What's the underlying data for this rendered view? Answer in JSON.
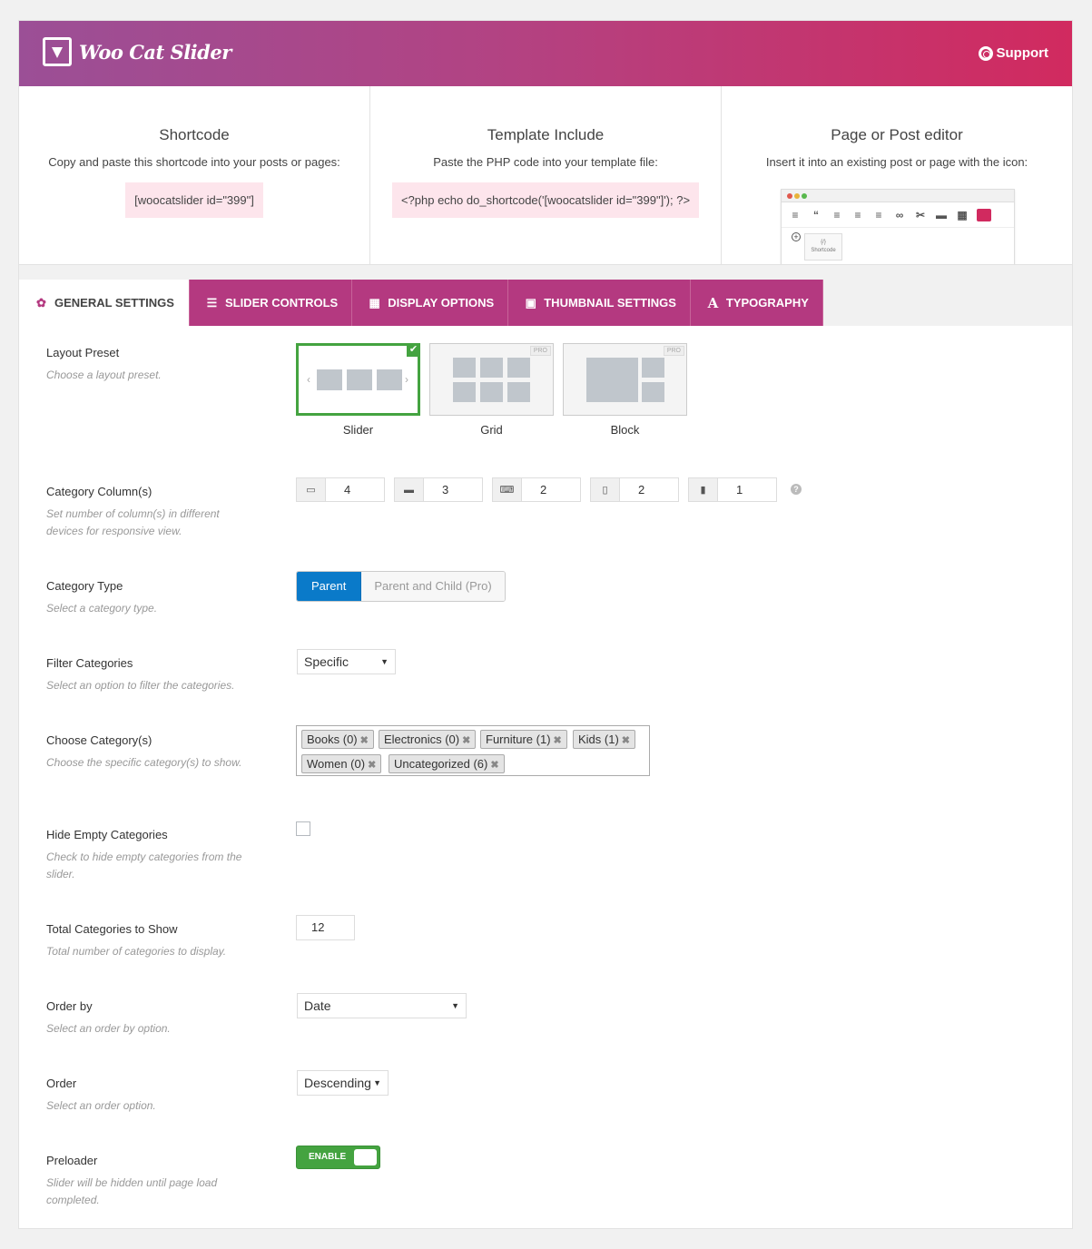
{
  "header": {
    "title": "Woo Cat Slider",
    "support_label": "Support"
  },
  "shortcode": {
    "title": "Shortcode",
    "desc": "Copy and paste this shortcode into your posts or pages:",
    "code": "[woocatslider id=\"399\"]"
  },
  "template": {
    "title": "Template Include",
    "desc": "Paste the PHP code into your template file:",
    "code": "<?php echo do_shortcode('[woocatslider id=\"399\"]'); ?>"
  },
  "editor": {
    "title": "Page or Post editor",
    "desc": "Insert it into an existing post or page with the icon:",
    "shortcode_label": "Shortcode",
    "shortcode_glyph": "{/}"
  },
  "tabs": [
    {
      "label": "General Settings",
      "icon": "gear-icon"
    },
    {
      "label": "Slider Controls",
      "icon": "sliders-icon"
    },
    {
      "label": "Display Options",
      "icon": "grid-icon"
    },
    {
      "label": "Thumbnail Settings",
      "icon": "image-icon"
    },
    {
      "label": "Typography",
      "icon": "font-icon"
    }
  ],
  "layout_preset": {
    "label": "Layout Preset",
    "desc": "Choose a layout preset.",
    "options": [
      {
        "name": "Slider",
        "selected": true
      },
      {
        "name": "Grid",
        "badge": "PRO"
      },
      {
        "name": "Block",
        "badge": "PRO"
      }
    ]
  },
  "columns": {
    "label": "Category Column(s)",
    "desc": "Set number of column(s) in different devices for responsive view.",
    "values": [
      "4",
      "3",
      "2",
      "2",
      "1"
    ],
    "icons": [
      "large-desktop-icon",
      "desktop-icon",
      "laptop-icon",
      "tablet-icon",
      "mobile-icon"
    ]
  },
  "category_type": {
    "label": "Category Type",
    "desc": "Select a category type.",
    "option_active": "Parent",
    "option_inactive": "Parent and Child (Pro)"
  },
  "filter": {
    "label": "Filter Categories",
    "desc": "Select an option to filter the categories.",
    "value": "Specific"
  },
  "choose": {
    "label": "Choose Category(s)",
    "desc": "Choose the specific category(s) to show.",
    "tags": [
      "Books (0)",
      "Electronics (0)",
      "Furniture (1)",
      "Kids (1)",
      "Women (0)",
      "Uncategorized (6)"
    ]
  },
  "hide_empty": {
    "label": "Hide Empty Categories",
    "desc": "Check to hide empty categories from the slider.",
    "checked": false
  },
  "total": {
    "label": "Total Categories to Show",
    "desc": "Total number of categories to display.",
    "value": "12"
  },
  "order_by": {
    "label": "Order by",
    "desc": "Select an order by option.",
    "value": "Date"
  },
  "order": {
    "label": "Order",
    "desc": "Select an order option.",
    "value": "Descending"
  },
  "preloader": {
    "label": "Preloader",
    "desc": "Slider will be hidden until page load completed.",
    "toggle_label": "ENABLE",
    "enabled": true
  },
  "colors": {
    "accent": "#b43980",
    "brand_end": "#d12a5f",
    "success": "#44a340",
    "primary": "#0a7ac9"
  }
}
